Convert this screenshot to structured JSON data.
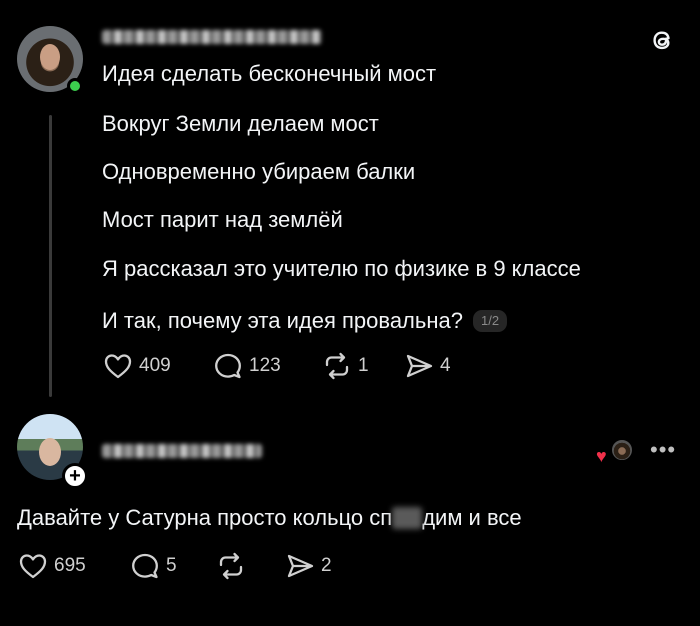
{
  "post": {
    "lines": [
      "Идея сделать бесконечный мост",
      "Вокруг Земли делаем мост",
      "Одновременно убираем балки",
      "Мост парит над землёй",
      "Я рассказал это учителю по физике в 9 классе",
      "И так, почему эта идея провальна?"
    ],
    "page_indicator": "1/2",
    "likes": "409",
    "replies": "123",
    "reposts": "1",
    "shares": "4"
  },
  "reply": {
    "text_before": "Давайте у Сатурна просто кольцо сп",
    "text_after": "дим и все",
    "likes": "695",
    "replies": "5",
    "shares": "2"
  },
  "icons": {
    "logo": "threads-logo-icon",
    "like": "heart-icon",
    "reply": "comment-icon",
    "repost": "repost-icon",
    "share": "send-icon",
    "more": "more-dots-icon"
  },
  "colors": {
    "online": "#3ccd4e",
    "liked_heart": "#f0304a"
  }
}
